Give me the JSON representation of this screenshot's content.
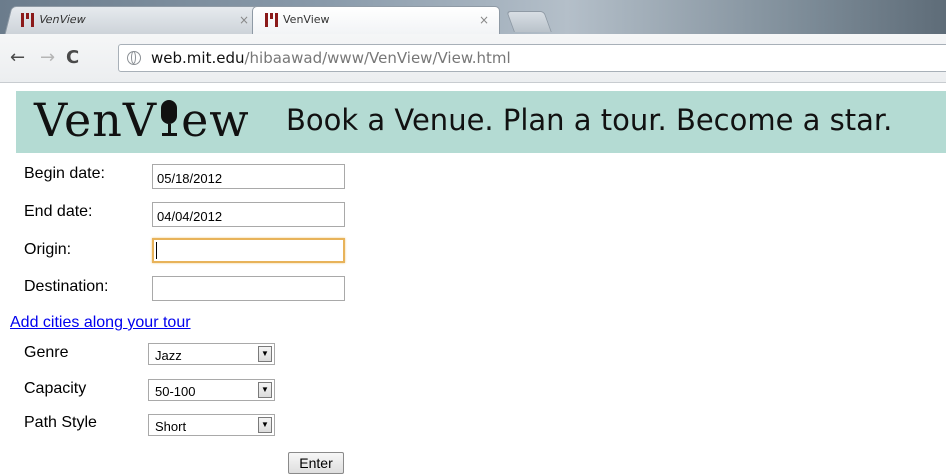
{
  "browser": {
    "tabs": [
      {
        "title": "VenView",
        "close": "×"
      },
      {
        "title": "VenView",
        "close": "×"
      }
    ],
    "nav": {
      "back": "←",
      "forward": "→",
      "reload": "C"
    },
    "url": {
      "host": "web.mit.edu",
      "path": "/hibaawad/www/VenView/View.html"
    }
  },
  "banner": {
    "logo_prefix": "VenV",
    "logo_suffix": "ew",
    "tagline": "Book a Venue. Plan a tour. Become a star."
  },
  "form": {
    "begin_date": {
      "label": "Begin date:",
      "value": "05/18/2012"
    },
    "end_date": {
      "label": "End date:",
      "value": "04/04/2012"
    },
    "origin": {
      "label": "Origin:",
      "value": ""
    },
    "destination": {
      "label": "Destination:",
      "value": ""
    },
    "add_cities_link": "Add cities along your tour",
    "genre": {
      "label": "Genre",
      "value": "Jazz"
    },
    "capacity": {
      "label": "Capacity",
      "value": "50-100"
    },
    "path_style": {
      "label": "Path Style",
      "value": "Short"
    },
    "select_arrow": "▼",
    "submit_label": "Enter"
  }
}
